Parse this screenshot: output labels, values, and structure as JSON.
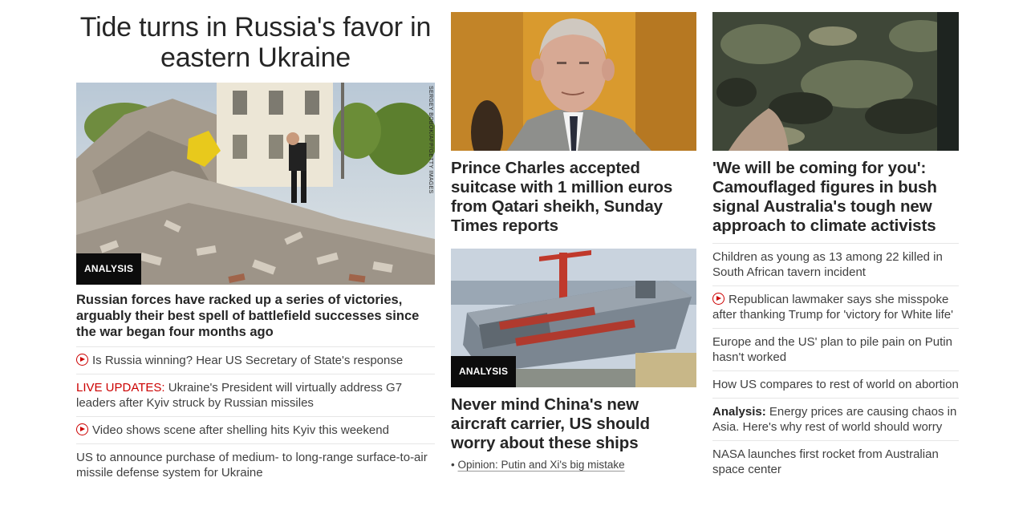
{
  "lead": {
    "title": "Tide turns in Russia's favor in eastern Ukraine",
    "image_credit": "SERGEY BOBOK/AFP/GETTY IMAGES",
    "badge": "ANALYSIS",
    "headline": "Russian forces have racked up a series of victories, arguably their best spell of battlefield successes since the war began four months ago",
    "related": [
      {
        "icon": "play-icon",
        "text": "Is Russia winning? Hear US Secretary of State's response"
      },
      {
        "prefix": "LIVE UPDATES:",
        "text": " Ukraine's President will virtually address G7 leaders after Kyiv struck by Russian missiles"
      },
      {
        "icon": "play-icon",
        "text": "Video shows scene after shelling hits Kyiv this weekend"
      },
      {
        "text": "US to announce purchase of medium- to long-range surface-to-air missile defense system for Ukraine"
      }
    ]
  },
  "middle": {
    "story1": {
      "headline": "Prince Charles accepted suitcase with 1 million euros from Qatari sheikh, Sunday Times reports"
    },
    "story2": {
      "badge": "ANALYSIS",
      "headline": "Never mind China's new aircraft carrier, US should worry about these ships",
      "opinion_bullet": "•",
      "opinion": "Opinion: Putin and Xi's big mistake"
    }
  },
  "right": {
    "story": {
      "headline": "'We will be coming for you': Camouflaged figures in bush signal Australia's tough new approach to climate activists"
    },
    "list": [
      {
        "text": "Children as young as 13 among 22 killed in South African tavern incident"
      },
      {
        "icon": "play-icon",
        "text": "Republican lawmaker says she misspoke after thanking Trump for 'victory for White life'"
      },
      {
        "text": "Europe and the US' plan to pile pain on Putin hasn't worked"
      },
      {
        "text": "How US compares to rest of world on abortion"
      },
      {
        "prefix": "Analysis:",
        "text": " Energy prices are causing chaos in Asia. Here's why rest of world should worry"
      },
      {
        "text": "NASA launches first rocket from Australian space center"
      }
    ]
  },
  "colors": {
    "live_red": "#cc0000",
    "badge_bg": "#0c0c0c",
    "text": "#262626",
    "divider": "#e6e6e6"
  }
}
